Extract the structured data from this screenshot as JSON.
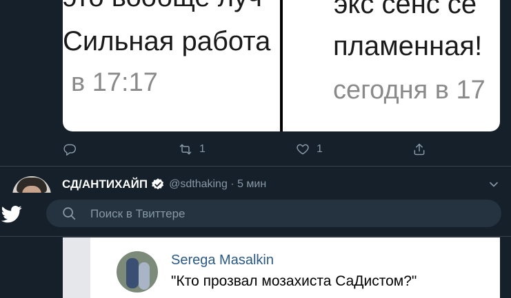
{
  "media": {
    "left_image": {
      "line1": "это вообще луч",
      "line2": "Сильная работа",
      "line3": "в 17:17"
    },
    "right_image": {
      "line1": "экс сенс се",
      "line2": "пламенная!",
      "line3": "сегодня в 17"
    }
  },
  "actions": {
    "reply_count": "",
    "retweet_count": "1",
    "like_count": "1"
  },
  "tweet": {
    "author_name": "СД/АНТИХАЙП",
    "handle_time": "@sdthaking · 5 мин"
  },
  "search": {
    "placeholder": "Поиск в Твиттере"
  },
  "embed": {
    "author": "Serega Masalkin",
    "quote": "\"Кто прозвал мозахиста СаДистом?\""
  },
  "colors": {
    "background": "#15202b",
    "muted": "#8899a6",
    "divider": "#38444d",
    "search_field": "#253341"
  }
}
